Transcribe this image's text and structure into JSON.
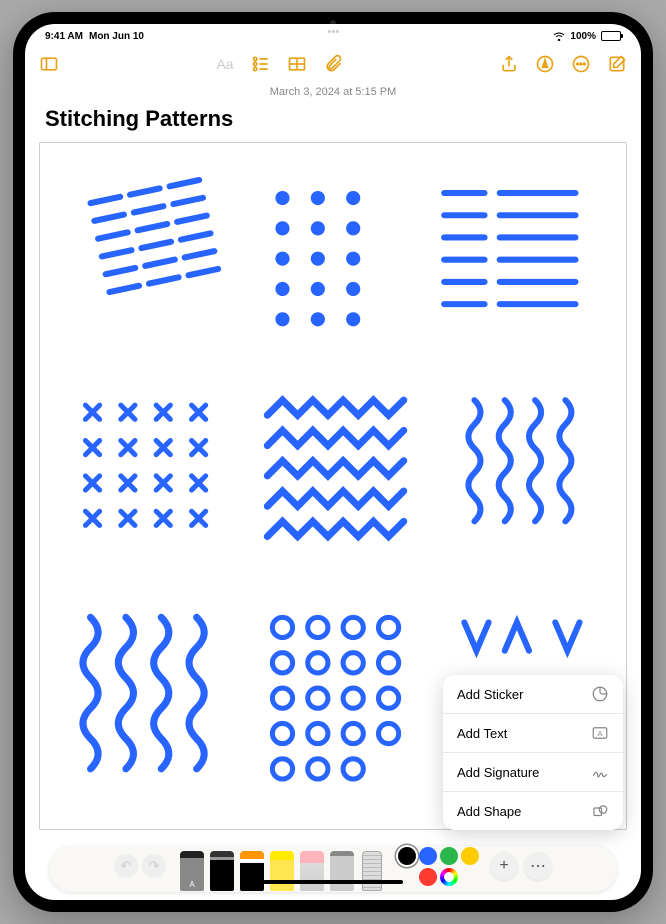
{
  "status": {
    "time": "9:41 AM",
    "date": "Mon Jun 10",
    "battery_pct": "100%"
  },
  "toolbar": {
    "sidebar_icon": "sidebar-icon",
    "format_icon": "Aa",
    "list_icon": "list-icon",
    "table_icon": "table-icon",
    "attach_icon": "paperclip-icon",
    "share_icon": "share-icon",
    "markup_icon": "markup-icon",
    "more_icon": "more-icon",
    "compose_icon": "compose-icon"
  },
  "note": {
    "date_line": "March 3, 2024 at 5:15 PM",
    "title": "Stitching Patterns"
  },
  "popup": {
    "items": [
      {
        "label": "Add Sticker",
        "icon": "sticker-icon"
      },
      {
        "label": "Add Text",
        "icon": "text-box-icon"
      },
      {
        "label": "Add Signature",
        "icon": "signature-icon"
      },
      {
        "label": "Add Shape",
        "icon": "shapes-icon"
      }
    ]
  },
  "palette": {
    "colors": [
      {
        "hex": "#000000",
        "selected": true
      },
      {
        "hex": "#2864ff"
      },
      {
        "hex": "#29b54a"
      },
      {
        "hex": "#ffcc00"
      },
      {
        "hex": "#ff3b30"
      }
    ]
  },
  "stroke_color": "#2864ff"
}
